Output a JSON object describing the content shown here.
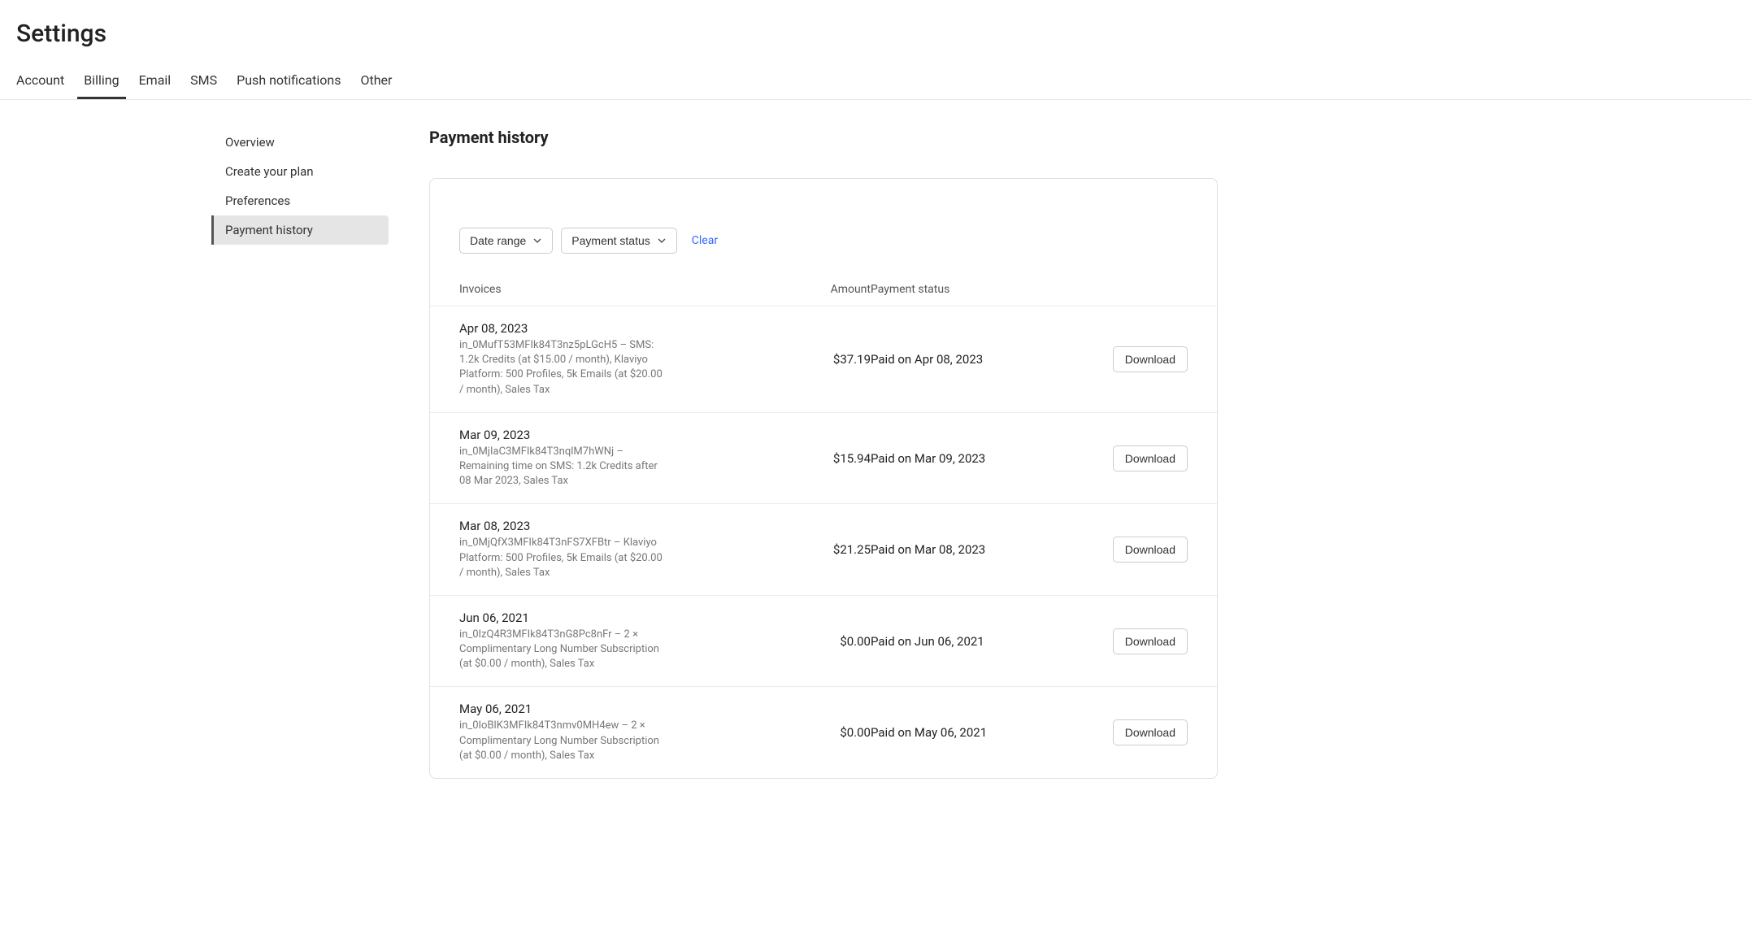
{
  "page": {
    "title": "Settings"
  },
  "topTabs": [
    {
      "label": "Account"
    },
    {
      "label": "Billing"
    },
    {
      "label": "Email"
    },
    {
      "label": "SMS"
    },
    {
      "label": "Push notifications"
    },
    {
      "label": "Other"
    }
  ],
  "sidebarItems": [
    {
      "label": "Overview"
    },
    {
      "label": "Create your plan"
    },
    {
      "label": "Preferences"
    },
    {
      "label": "Payment history"
    }
  ],
  "section": {
    "title": "Payment history"
  },
  "filters": {
    "dateRangeLabel": "Date range",
    "paymentStatusLabel": "Payment status",
    "clearLabel": "Clear"
  },
  "tableHeaders": {
    "invoices": "Invoices",
    "amount": "Amount",
    "paymentStatus": "Payment status"
  },
  "downloadLabel": "Download",
  "invoices": [
    {
      "date": "Apr 08, 2023",
      "desc": "in_0MufT53MFIk84T3nz5pLGcH5 – SMS: 1.2k Credits (at $15.00 / month), Klaviyo Platform: 500 Profiles, 5k Emails (at $20.00 / month), Sales Tax",
      "amount": "$37.19",
      "status": "Paid on Apr 08, 2023"
    },
    {
      "date": "Mar 09, 2023",
      "desc": "in_0MjIaC3MFIk84T3nqlM7hWNj – Remaining time on SMS: 1.2k Credits after 08 Mar 2023, Sales Tax",
      "amount": "$15.94",
      "status": "Paid on Mar 09, 2023"
    },
    {
      "date": "Mar 08, 2023",
      "desc": "in_0MjQfX3MFIk84T3nFS7XFBtr – Klaviyo Platform: 500 Profiles, 5k Emails (at $20.00 / month), Sales Tax",
      "amount": "$21.25",
      "status": "Paid on Mar 08, 2023"
    },
    {
      "date": "Jun 06, 2021",
      "desc": "in_0IzQ4R3MFIk84T3nG8Pc8nFr – 2 × Complimentary Long Number Subscription (at $0.00 / month), Sales Tax",
      "amount": "$0.00",
      "status": "Paid on Jun 06, 2021"
    },
    {
      "date": "May 06, 2021",
      "desc": "in_0IoBlK3MFIk84T3nmv0MH4ew – 2 × Complimentary Long Number Subscription (at $0.00 / month), Sales Tax",
      "amount": "$0.00",
      "status": "Paid on May 06, 2021"
    }
  ]
}
